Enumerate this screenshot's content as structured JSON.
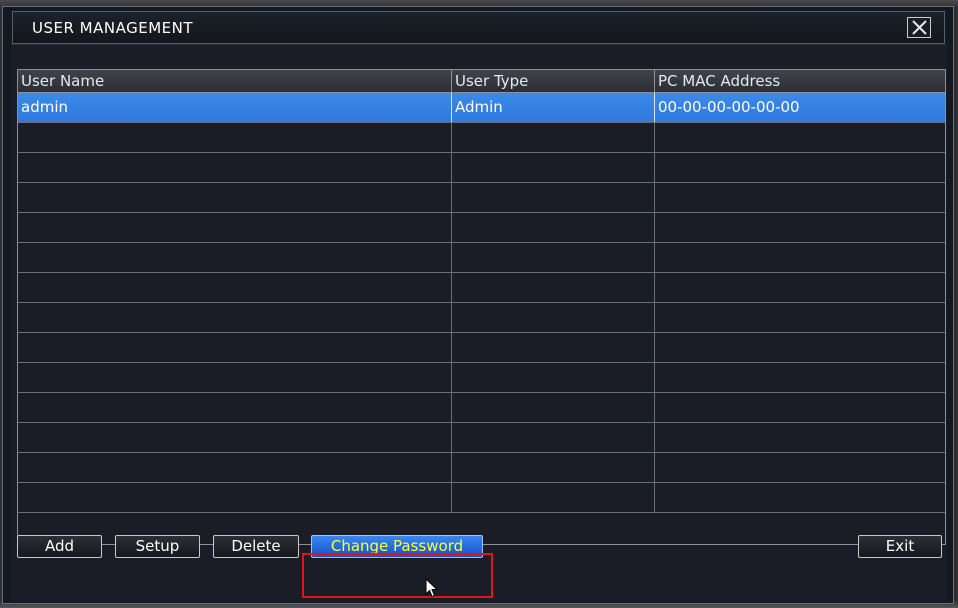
{
  "window": {
    "title": "USER MANAGEMENT"
  },
  "table": {
    "columns": [
      "User Name",
      "User Type",
      "PC MAC Address"
    ],
    "rows": [
      {
        "user_name": "admin",
        "user_type": "Admin",
        "mac": "00-00-00-00-00-00",
        "selected": true
      }
    ],
    "total_visible_rows": 14
  },
  "buttons": {
    "add": "Add",
    "setup": "Setup",
    "delete": "Delete",
    "change_password": "Change Password",
    "exit": "Exit"
  },
  "colors": {
    "selected_row": "#3083e4",
    "primary_button_text": "#ffff33",
    "highlight": "#e2141b"
  }
}
